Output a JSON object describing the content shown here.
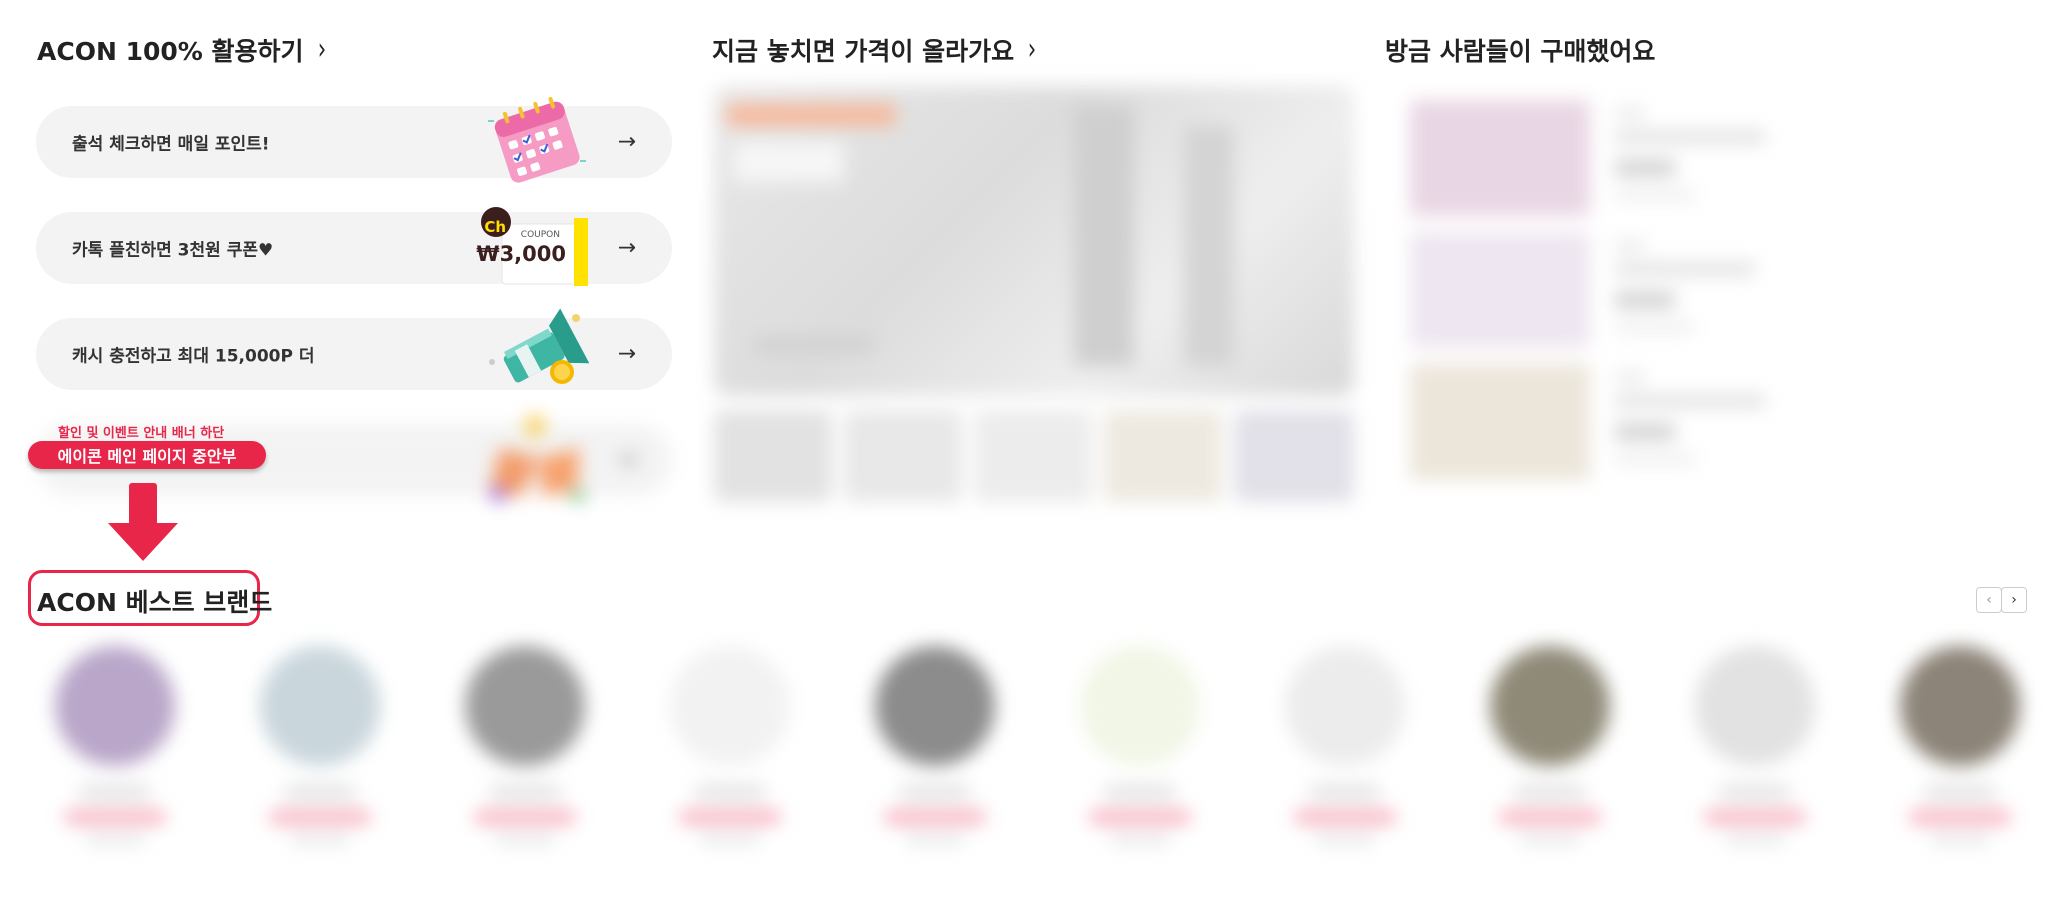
{
  "sections": {
    "acon_guide": {
      "title": "ACON 100% 활용하기",
      "chevron": "›"
    },
    "price_rising": {
      "title": "지금 놓치면 가격이 올라가요",
      "chevron": "›"
    },
    "recent_purchase": {
      "title": "방금 사람들이 구매했어요"
    }
  },
  "banners": [
    {
      "label": "출석 체크하면 매일 포인트!",
      "arrow": "→",
      "icon": "calendar-icon"
    },
    {
      "label": "카톡 플친하면 3천원 쿠폰♥",
      "arrow": "→",
      "icon": "coupon-icon",
      "coupon": {
        "badge": "Ch",
        "caption": "COUPON",
        "amount": "₩3,000"
      }
    },
    {
      "label": "캐시 충전하고 최대 15,000P 더",
      "arrow": "→",
      "icon": "cash-megaphone-icon"
    },
    {
      "label": "",
      "arrow": "→",
      "icon": "discount-icon"
    }
  ],
  "annotation": {
    "small": "할인 및 이벤트 안내 배너 하단",
    "pill": "에이콘 메인 페이지 중안부"
  },
  "best_brand": {
    "title": "ACON 베스트 브랜드",
    "prev": "‹",
    "next": "›"
  },
  "colors": {
    "accent": "#e8264a",
    "banner_bg": "#f3f3f3",
    "coupon_yellow": "#ffe200"
  }
}
